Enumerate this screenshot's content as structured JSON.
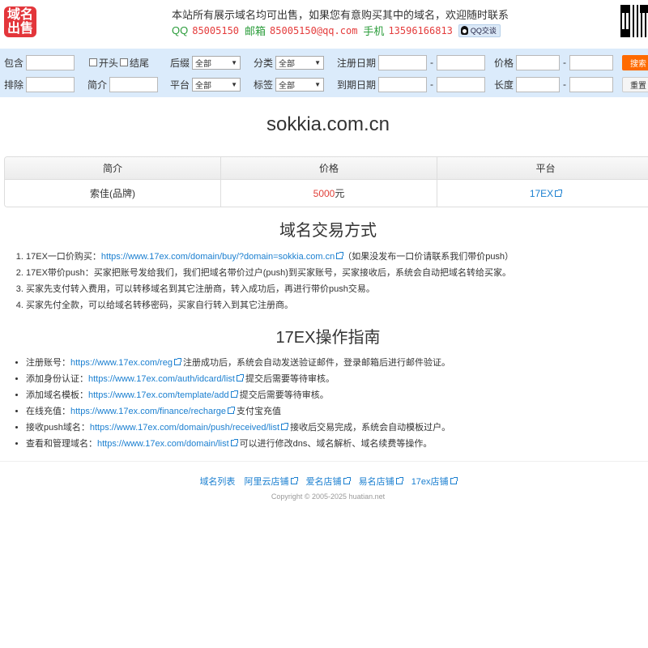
{
  "header": {
    "logo_line1": "域名",
    "logo_line2": "出售",
    "intro": "本站所有展示域名均可出售，如果您有意购买其中的域名，欢迎随时联系",
    "qq_label": "QQ",
    "qq_value": "85005150",
    "email_label": "邮箱",
    "email_value": "85005150@qq.com",
    "phone_label": "手机",
    "phone_value": "13596166813",
    "qq_chat": "QQ交谈"
  },
  "search": {
    "contains_label": "包含",
    "start_label": "开头",
    "end_label": "结尾",
    "suffix_label": "后缀",
    "suffix_value": "全部",
    "category_label": "分类",
    "category_value": "全部",
    "reg_date_label": "注册日期",
    "price_label": "价格",
    "exclude_label": "排除",
    "intro_label": "简介",
    "platform_label": "平台",
    "platform_value": "全部",
    "tag_label": "标签",
    "tag_value": "全部",
    "exp_date_label": "到期日期",
    "length_label": "长度",
    "range_sep": "-",
    "search_button": "搜索",
    "reset_button": "重置"
  },
  "domain": {
    "name": "sokkia.com.cn",
    "headers": [
      "简介",
      "价格",
      "平台"
    ],
    "intro": "索佳(品牌)",
    "price": "5000",
    "price_unit": "元",
    "platform": "17EX"
  },
  "trade": {
    "title": "域名交易方式",
    "items": [
      {
        "prefix": "17EX一口价购买：",
        "link": "https://www.17ex.com/domain/buy/?domain=sokkia.com.cn",
        "suffix": "（如果没发布一口价请联系我们带价push）"
      },
      {
        "text": "17EX带价push：买家把账号发给我们，我们把域名带价过户(push)到买家账号，买家接收后，系统会自动把域名转给买家。"
      },
      {
        "text": "买家先支付转入费用，可以转移域名到其它注册商，转入成功后，再进行带价push交易。"
      },
      {
        "text": "买家先付全款，可以给域名转移密码，买家自行转入到其它注册商。"
      }
    ]
  },
  "guide": {
    "title": "17EX操作指南",
    "items": [
      {
        "prefix": "注册账号：",
        "link": "https://www.17ex.com/reg",
        "suffix": " 注册成功后，系统会自动发送验证邮件，登录邮箱后进行邮件验证。"
      },
      {
        "prefix": "添加身份认证：",
        "link": "https://www.17ex.com/auth/idcard/list",
        "suffix": " 提交后需要等待审核。"
      },
      {
        "prefix": "添加域名模板：",
        "link": "https://www.17ex.com/template/add",
        "suffix": " 提交后需要等待审核。"
      },
      {
        "prefix": "在线充值：",
        "link": "https://www.17ex.com/finance/recharge",
        "suffix": " 支付宝充值"
      },
      {
        "prefix": "接收push域名：",
        "link": "https://www.17ex.com/domain/push/received/list",
        "suffix": " 接收后交易完成，系统会自动模板过户。"
      },
      {
        "prefix": "查看和管理域名：",
        "link": "https://www.17ex.com/domain/list",
        "suffix": " 可以进行修改dns、域名解析、域名续费等操作。"
      }
    ]
  },
  "footer": {
    "links": [
      "域名列表",
      "阿里云店铺",
      "爱名店铺",
      "易名店铺",
      "17ex店铺"
    ],
    "copyright": "Copyright © 2005-2025 huatian.net"
  }
}
